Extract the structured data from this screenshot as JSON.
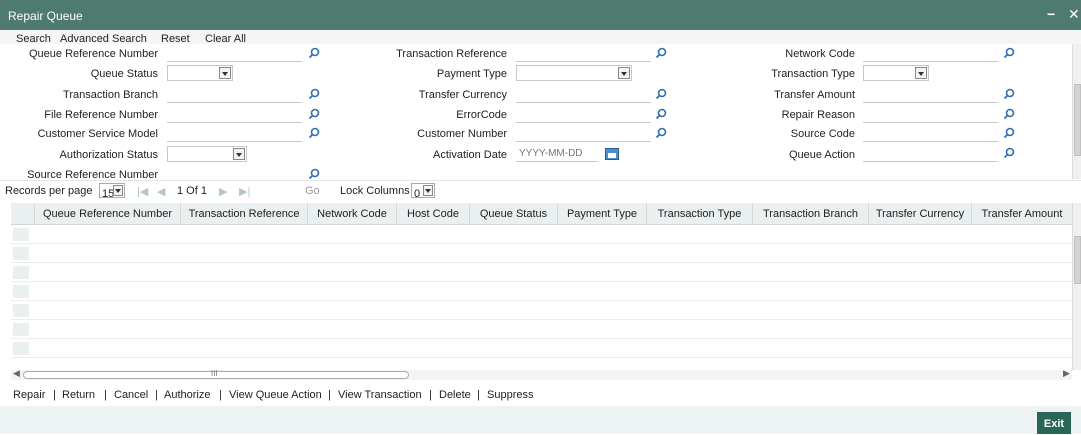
{
  "window": {
    "title": "Repair Queue",
    "minimize": "−",
    "close": "✕"
  },
  "toolbar": {
    "search": "Search",
    "advanced_search": "Advanced Search",
    "reset": "Reset",
    "clear_all": "Clear All"
  },
  "form": {
    "queue_reference_number": "Queue Reference Number",
    "transaction_reference": "Transaction Reference",
    "network_code": "Network Code",
    "queue_status": "Queue Status",
    "payment_type": "Payment Type",
    "transaction_type": "Transaction Type",
    "transaction_branch": "Transaction Branch",
    "transfer_currency": "Transfer Currency",
    "transfer_amount": "Transfer Amount",
    "file_reference_number": "File Reference Number",
    "error_code": "ErrorCode",
    "repair_reason": "Repair Reason",
    "customer_service_model": "Customer Service Model",
    "customer_number": "Customer Number",
    "source_code": "Source Code",
    "authorization_status": "Authorization Status",
    "activation_date": "Activation Date",
    "activation_date_placeholder": "YYYY-MM-DD",
    "queue_action": "Queue Action",
    "source_reference_number": "Source Reference Number"
  },
  "pager": {
    "records_per_page": "Records per page",
    "per_page_value": "15",
    "page_text": "1 Of 1",
    "go": "Go",
    "lock_columns": "Lock Columns",
    "lock_columns_value": "0"
  },
  "grid": {
    "columns": [
      "Queue Reference Number",
      "Transaction Reference",
      "Network Code",
      "Host Code",
      "Queue Status",
      "Payment Type",
      "Transaction Type",
      "Transaction Branch",
      "Transfer Currency",
      "Transfer Amount"
    ]
  },
  "actions": {
    "repair": "Repair",
    "return": "Return",
    "cancel": "Cancel",
    "authorize": "Authorize",
    "view_queue_action": "View Queue Action",
    "view_transaction": "View Transaction",
    "delete": "Delete",
    "suppress": "Suppress",
    "separator": "|"
  },
  "footer": {
    "exit": "Exit",
    "hscroll_grip": "III"
  },
  "colors": {
    "titlebar": "#4e7a70",
    "exit_button": "#2a6657",
    "header_bg": "#eaefef",
    "search_icon": "#2f6fb0"
  }
}
